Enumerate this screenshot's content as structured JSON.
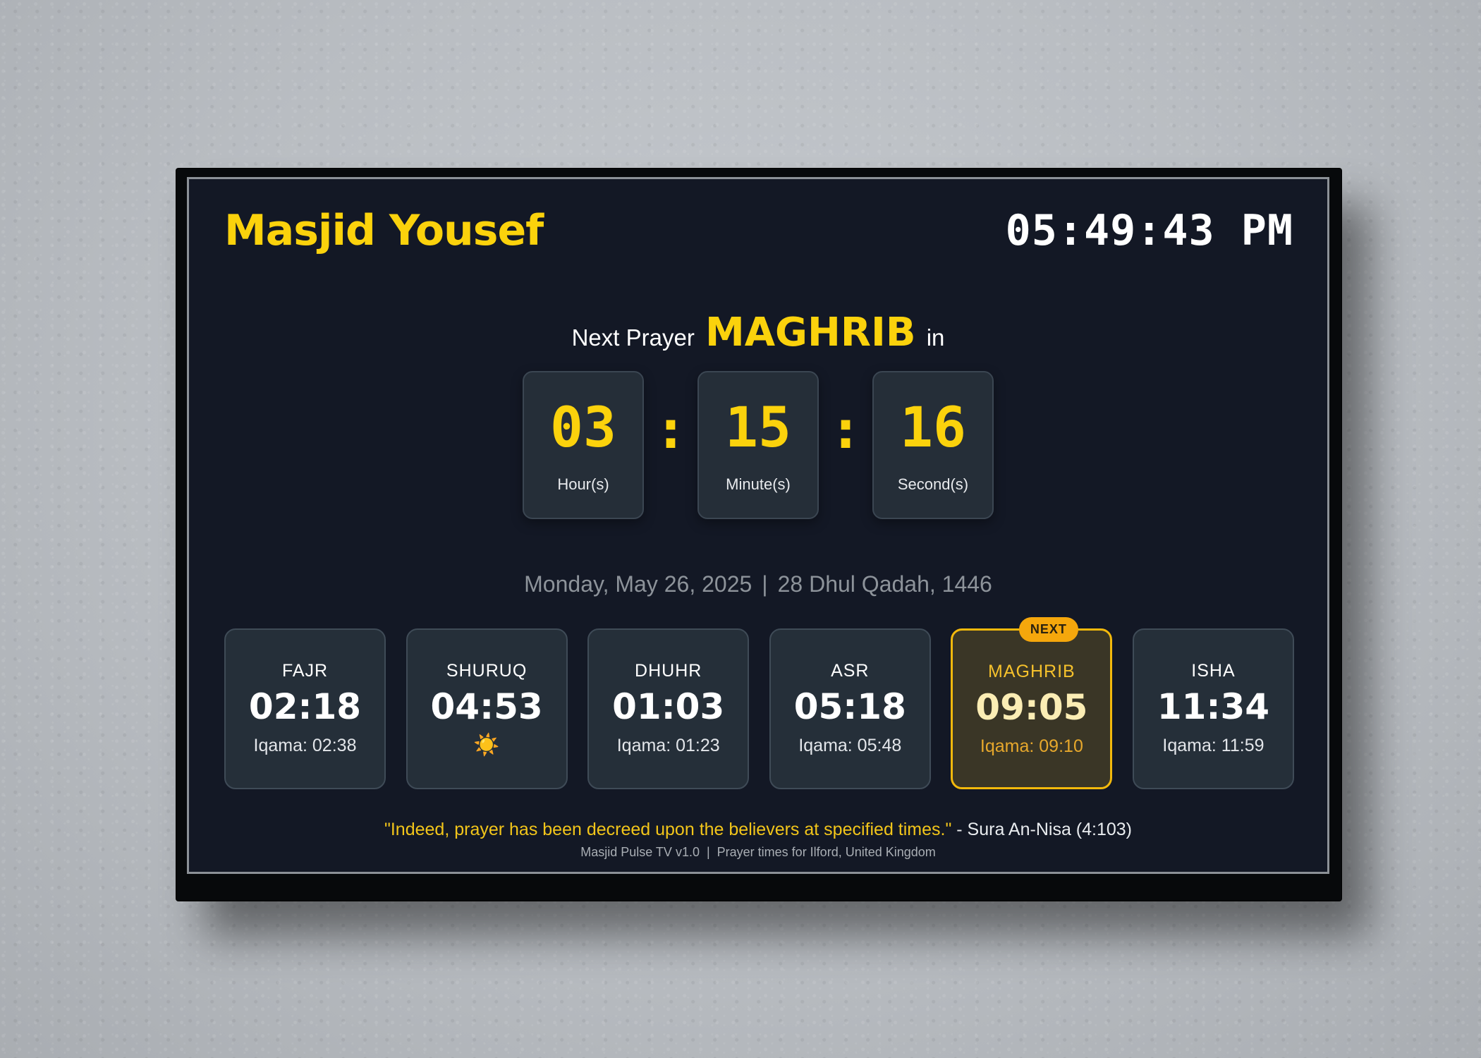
{
  "header": {
    "mosque_name": "Masjid Yousef",
    "clock": "05:49:43 PM"
  },
  "next_prayer": {
    "prefix": "Next Prayer",
    "name": "MAGHRIB",
    "suffix": "in"
  },
  "countdown": {
    "hours": "03",
    "hours_label": "Hour(s)",
    "minutes": "15",
    "minutes_label": "Minute(s)",
    "seconds": "16",
    "seconds_label": "Second(s)",
    "separator": ":"
  },
  "date": {
    "gregorian": "Monday, May 26, 2025",
    "separator": "|",
    "hijri": "28 Dhul Qadah, 1446"
  },
  "prayers": [
    {
      "name": "FAJR",
      "time": "02:18",
      "iqama": "Iqama: 02:38"
    },
    {
      "name": "SHURUQ",
      "time": "04:53",
      "icon": "sun-icon",
      "icon_glyph": "☀️"
    },
    {
      "name": "DHUHR",
      "time": "01:03",
      "iqama": "Iqama: 01:23"
    },
    {
      "name": "ASR",
      "time": "05:18",
      "iqama": "Iqama: 05:48"
    },
    {
      "name": "MAGHRIB",
      "time": "09:05",
      "iqama": "Iqama: 09:10",
      "badge": "NEXT"
    },
    {
      "name": "ISHA",
      "time": "11:34",
      "iqama": "Iqama: 11:59"
    }
  ],
  "quote": {
    "text": "\"Indeed, prayer has been decreed upon the believers at specified times.\"",
    "source": " - Sura An-Nisa (4:103)"
  },
  "footer": {
    "app": "Masjid Pulse TV v1.0",
    "separator": "|",
    "location": "Prayer times for Ilford, United Kingdom"
  },
  "colors": {
    "accent": "#fbd20c",
    "background": "#131825",
    "card": "#252f39",
    "badge": "#f5a70c"
  }
}
